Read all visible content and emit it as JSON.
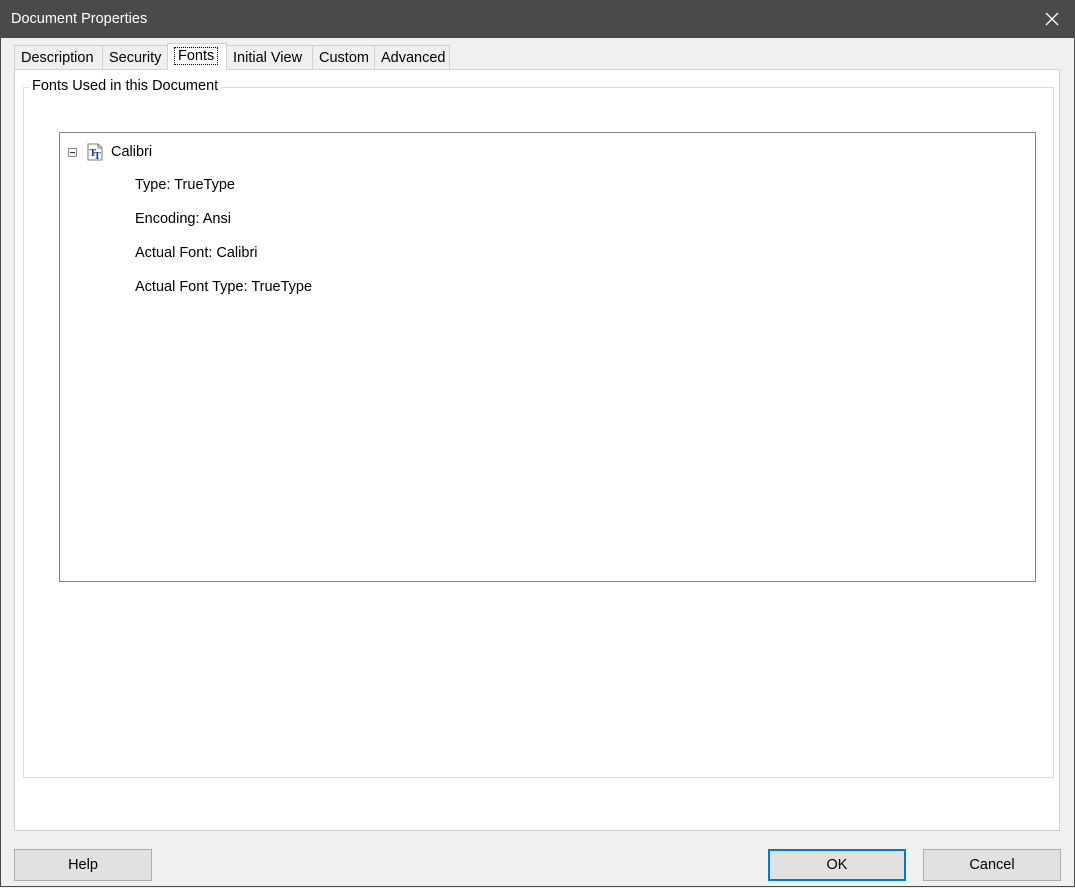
{
  "window": {
    "title": "Document Properties"
  },
  "tabs": [
    {
      "label": "Description"
    },
    {
      "label": "Security"
    },
    {
      "label": "Fonts"
    },
    {
      "label": "Initial View"
    },
    {
      "label": "Custom"
    },
    {
      "label": "Advanced"
    }
  ],
  "active_tab": "Fonts",
  "fonts_group": {
    "title": "Fonts Used in this Document",
    "fonts": [
      {
        "name": "Calibri",
        "expanded": true,
        "properties": [
          "Type: TrueType",
          "Encoding: Ansi",
          "Actual Font: Calibri",
          "Actual Font Type: TrueType"
        ]
      }
    ]
  },
  "buttons": {
    "help": "Help",
    "ok": "OK",
    "cancel": "Cancel"
  },
  "colors": {
    "titlebar": "#4a4a4a",
    "default_button_border": "#0078d7"
  },
  "icons": {
    "close": "close-icon",
    "collapse": "collapse-icon",
    "font": "truetype-font-icon"
  }
}
